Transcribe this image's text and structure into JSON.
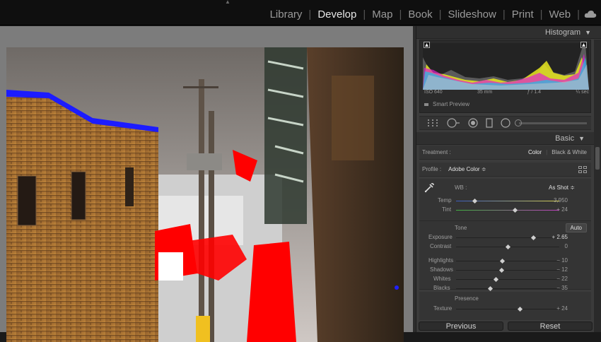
{
  "modules": [
    "Library",
    "Develop",
    "Map",
    "Book",
    "Slideshow",
    "Print",
    "Web"
  ],
  "active_module": "Develop",
  "panels": {
    "histogram_title": "Histogram",
    "basic_title": "Basic"
  },
  "histogram": {
    "iso": "ISO 640",
    "focal": "35 mm",
    "aperture": "ƒ / 1.4",
    "shutter": "¼ sec",
    "smart_preview": "Smart Preview"
  },
  "basic": {
    "treatment_label": "Treatment :",
    "treatment_options": [
      "Color",
      "Black & White"
    ],
    "treatment_selected": "Color",
    "profile_label": "Profile :",
    "profile_value": "Adobe Color ≑",
    "wb_label": "WB :",
    "wb_value": "As Shot ≑",
    "temp": {
      "label": "Temp",
      "value": "3,950",
      "pos": 0.18
    },
    "tint": {
      "label": "Tint",
      "value": "+ 24",
      "pos": 0.57
    },
    "tone_label": "Tone",
    "auto_label": "Auto",
    "exposure": {
      "label": "Exposure",
      "value": "+ 2.65",
      "pos": 0.75
    },
    "contrast": {
      "label": "Contrast",
      "value": "0",
      "pos": 0.5
    },
    "highlights": {
      "label": "Highlights",
      "value": "− 10",
      "pos": 0.45
    },
    "shadows": {
      "label": "Shadows",
      "value": "− 12",
      "pos": 0.44
    },
    "whites": {
      "label": "Whites",
      "value": "− 22",
      "pos": 0.39
    },
    "blacks": {
      "label": "Blacks",
      "value": "− 35",
      "pos": 0.33
    },
    "presence_label": "Presence",
    "texture": {
      "label": "Texture",
      "value": "+ 24",
      "pos": 0.62
    }
  },
  "buttons": {
    "previous": "Previous",
    "reset": "Reset"
  },
  "colors": {
    "clipping_highlight": "#ff0000",
    "clipping_shadow": "#0000ff",
    "active_module": "#e6e6e6"
  }
}
